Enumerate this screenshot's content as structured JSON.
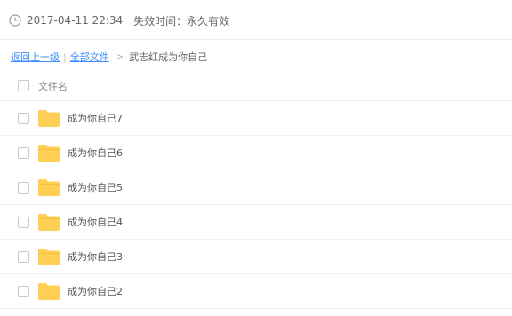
{
  "share_info": {
    "clock_icon": "clock-icon",
    "time": "2017-04-11 22:34",
    "expire_label": "失效时间：",
    "expire_value": "永久有效"
  },
  "breadcrumb": {
    "back": "返回上一级",
    "separator": "|",
    "all_files": "全部文件",
    "arrow": ">",
    "current": "武志红成为你自己"
  },
  "list": {
    "header": "文件名",
    "folder_color": "#ffce55",
    "items": [
      {
        "name": "成为你自己7",
        "icon": "folder-icon"
      },
      {
        "name": "成为你自己6",
        "icon": "folder-icon"
      },
      {
        "name": "成为你自己5",
        "icon": "folder-icon"
      },
      {
        "name": "成为你自己4",
        "icon": "folder-icon"
      },
      {
        "name": "成为你自己3",
        "icon": "folder-icon"
      },
      {
        "name": "成为你自己2",
        "icon": "folder-icon"
      }
    ]
  }
}
